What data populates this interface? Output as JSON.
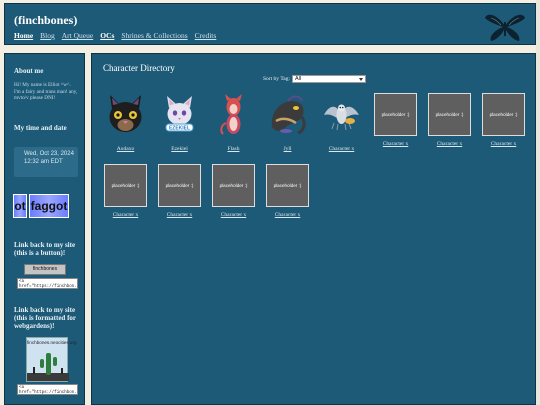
{
  "header": {
    "title": "(finchbones)",
    "nav": [
      "Home",
      "Blog",
      "Art Queue",
      "OCs",
      "Shrines & Collections",
      "Credits"
    ]
  },
  "sidebar": {
    "about_heading": "About me",
    "about_text": "Hi! My name is Elliot ^w^. I'm a fairy and trans man! any, mvto/v please DNI!",
    "time_heading": "My time and date",
    "date": "Wed, Oct 23, 2024",
    "time": "12:32 am EDT",
    "flag_words": [
      "ot",
      "faggot"
    ],
    "link_button_heading": "Link back to my site (this is a button)!",
    "button_text": "finchbones",
    "code_1": "<a href=\"https://finchbon...",
    "link_webgarden_heading": "Link back to my site (this is formatted for webgardens)!",
    "banner_text": "finchbones.neocities.org",
    "code_2": "<a href=\"https://finchbon..."
  },
  "main": {
    "title": "Character Directory",
    "sort_label": "Sort by Tag:",
    "sort_value": "All",
    "placeholder_text": "placeholder :)",
    "characters": [
      {
        "name": "Audaxo"
      },
      {
        "name": "Ezekiel"
      },
      {
        "name": "Flash"
      },
      {
        "name": "Jyll"
      },
      {
        "name": "Character x"
      },
      {
        "name": "Character x"
      },
      {
        "name": "Character x"
      },
      {
        "name": "Character x"
      },
      {
        "name": "Character x"
      },
      {
        "name": "Character x"
      },
      {
        "name": "Character x"
      },
      {
        "name": "Character x"
      }
    ]
  }
}
